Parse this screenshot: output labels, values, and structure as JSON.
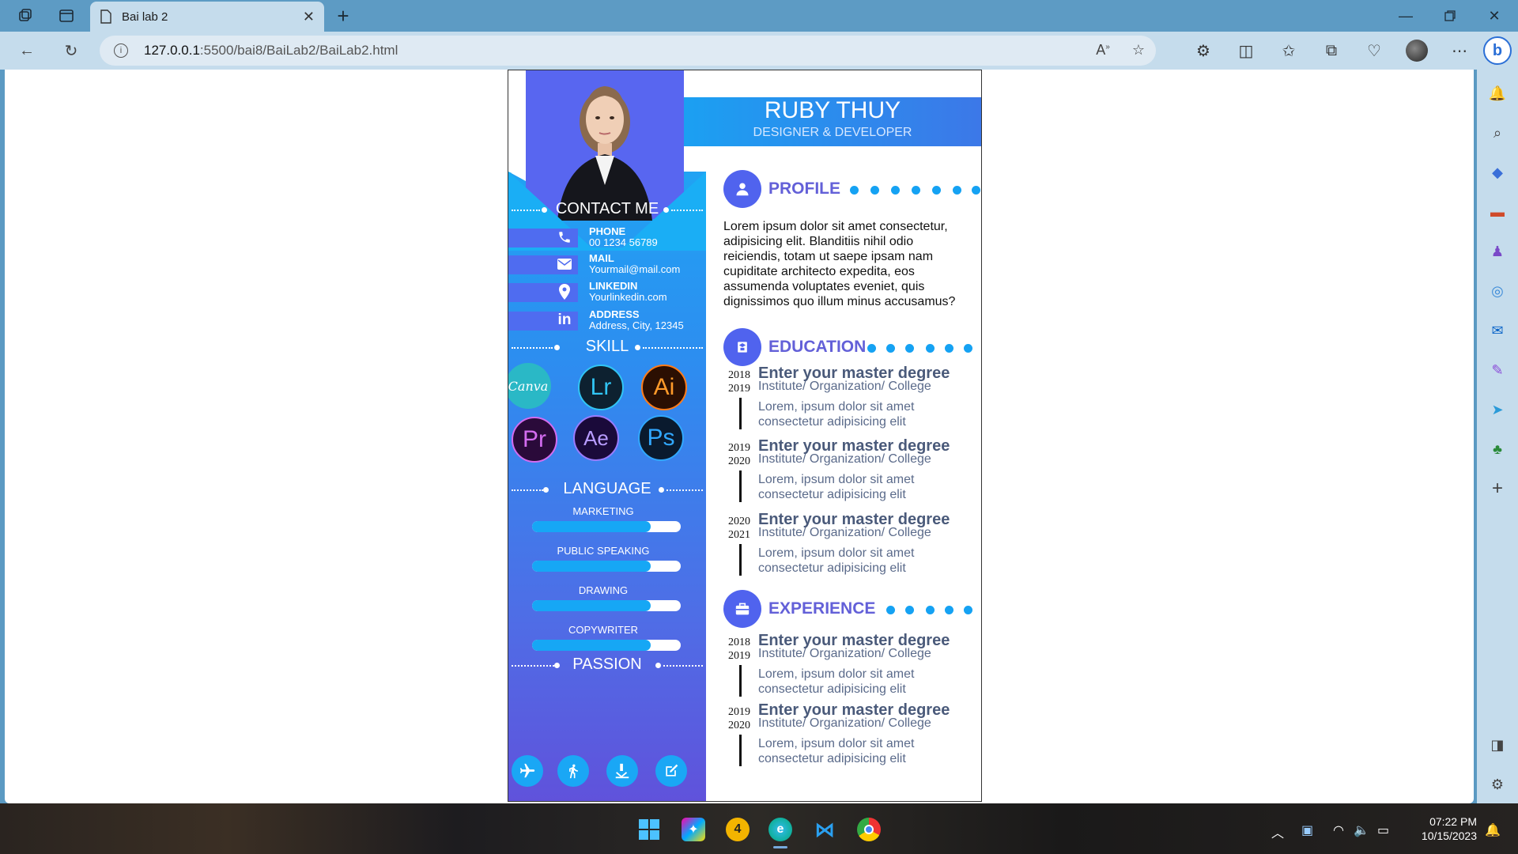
{
  "browser": {
    "tab_title": "Bai lab 2",
    "url_host": "127.0.0.1",
    "url_path": ":5500/bai8/BaiLab2/BaiLab2.html"
  },
  "cv": {
    "name": "RUBY THUY",
    "role": "DESIGNER & DEVELOPER",
    "contact_title": "CONTACT ME",
    "contacts": [
      {
        "title": "PHONE",
        "value": "00 1234 56789",
        "icon": "phone-icon"
      },
      {
        "title": "MAIL",
        "value": "Yourmail@mail.com",
        "icon": "mail-icon"
      },
      {
        "title": "LINKEDIN",
        "value": "Yourlinkedin.com",
        "icon": "location-pin-icon"
      },
      {
        "title": "ADDRESS",
        "value": "Address, City, 12345",
        "icon": "linkedin-icon"
      }
    ],
    "skill_title": "SKILL",
    "skills": [
      "Canva",
      "Lr",
      "Ai",
      "Pr",
      "Ae",
      "Ps"
    ],
    "language_title": "LANGUAGE",
    "languages": [
      {
        "label": "MARKETING",
        "level": 0.8
      },
      {
        "label": "PUBLIC SPEAKING",
        "level": 0.8
      },
      {
        "label": "DRAWING",
        "level": 0.8
      },
      {
        "label": "COPYWRITER",
        "level": 0.8
      }
    ],
    "passion_title": "PASSION",
    "passions": [
      "airplane-icon",
      "walking-icon",
      "reading-icon",
      "edit-icon"
    ],
    "profile_title": "PROFILE",
    "profile_text": "Lorem ipsum dolor sit amet consectetur, adipisicing elit. Blanditiis nihil odio reiciendis, totam ut saepe ipsam nam cupiditate architecto expedita, eos assumenda voluptates eveniet, quis dignissimos quo illum minus accusamus?",
    "education_title": "EDUCATION",
    "education": [
      {
        "y1": "2018",
        "y2": "2019",
        "title": "Enter your master degree",
        "sub": "Institute/ Organization/ College",
        "desc": "Lorem, ipsum dolor sit amet consectetur adipisicing elit"
      },
      {
        "y1": "2019",
        "y2": "2020",
        "title": "Enter your master degree",
        "sub": "Institute/ Organization/ College",
        "desc": "Lorem, ipsum dolor sit amet consectetur adipisicing elit"
      },
      {
        "y1": "2020",
        "y2": "2021",
        "title": "Enter your master degree",
        "sub": "Institute/ Organization/ College",
        "desc": "Lorem, ipsum dolor sit amet consectetur adipisicing elit"
      }
    ],
    "experience_title": "EXPERIENCE",
    "experience": [
      {
        "y1": "2018",
        "y2": "2019",
        "title": "Enter your master degree",
        "sub": "Institute/ Organization/ College",
        "desc": "Lorem, ipsum dolor sit amet consectetur adipisicing elit"
      },
      {
        "y1": "2019",
        "y2": "2020",
        "title": "Enter your master degree",
        "sub": "Institute/ Organization/ College",
        "desc": "Lorem, ipsum dolor sit amet consectetur adipisicing elit"
      }
    ]
  },
  "taskbar": {
    "time": "07:22 PM",
    "date": "10/15/2023"
  },
  "colors": {
    "accent": "#5063ee",
    "title_purple": "#6360d8",
    "dot_blue": "#15a2f3"
  }
}
